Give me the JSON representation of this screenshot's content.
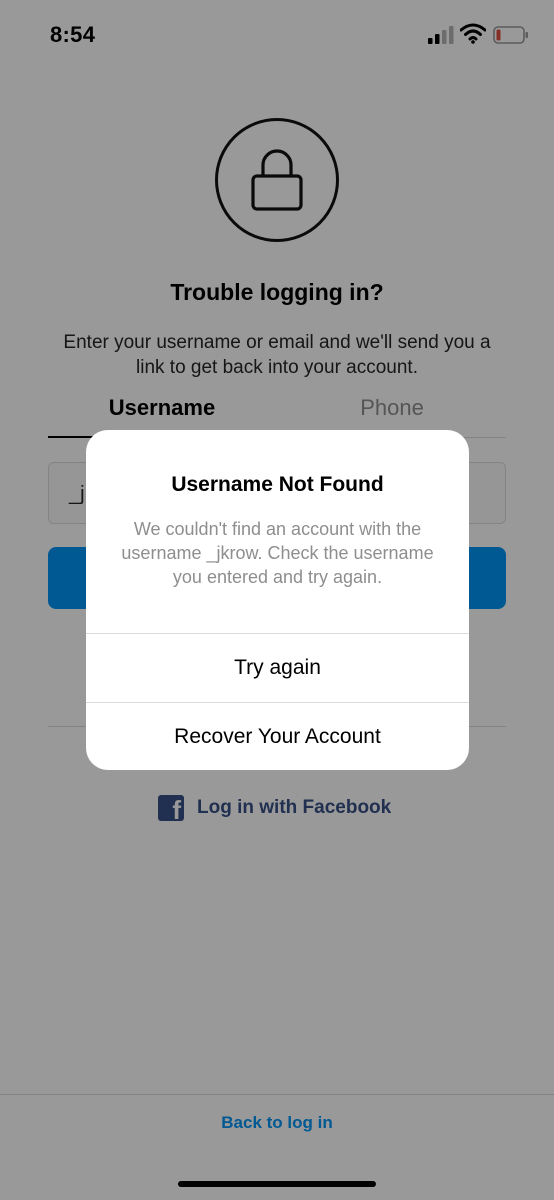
{
  "status_bar": {
    "time": "8:54",
    "icons": [
      "signal-icon",
      "wifi-icon",
      "battery-icon"
    ],
    "battery_color": "#e04f3c"
  },
  "main": {
    "title": "Trouble logging in?",
    "subtitle": "Enter your username or email and we'll send you a link to get back into your account.",
    "tabs": [
      {
        "label": "Username",
        "active": true
      },
      {
        "label": "Phone",
        "active": false
      }
    ],
    "input_value_partial": "_j",
    "facebook_label": "Log in with Facebook",
    "back_to_login": "Back to log in"
  },
  "dialog": {
    "title": "Username Not Found",
    "message": "We couldn't find an account with the username _jkrow. Check the username you entered and try again.",
    "buttons": [
      {
        "label": "Try again"
      },
      {
        "label": "Recover Your Account"
      }
    ]
  },
  "colors": {
    "accent": "#0095f6",
    "facebook": "#385185",
    "overlay": "rgba(0,0,0,0.40)"
  }
}
